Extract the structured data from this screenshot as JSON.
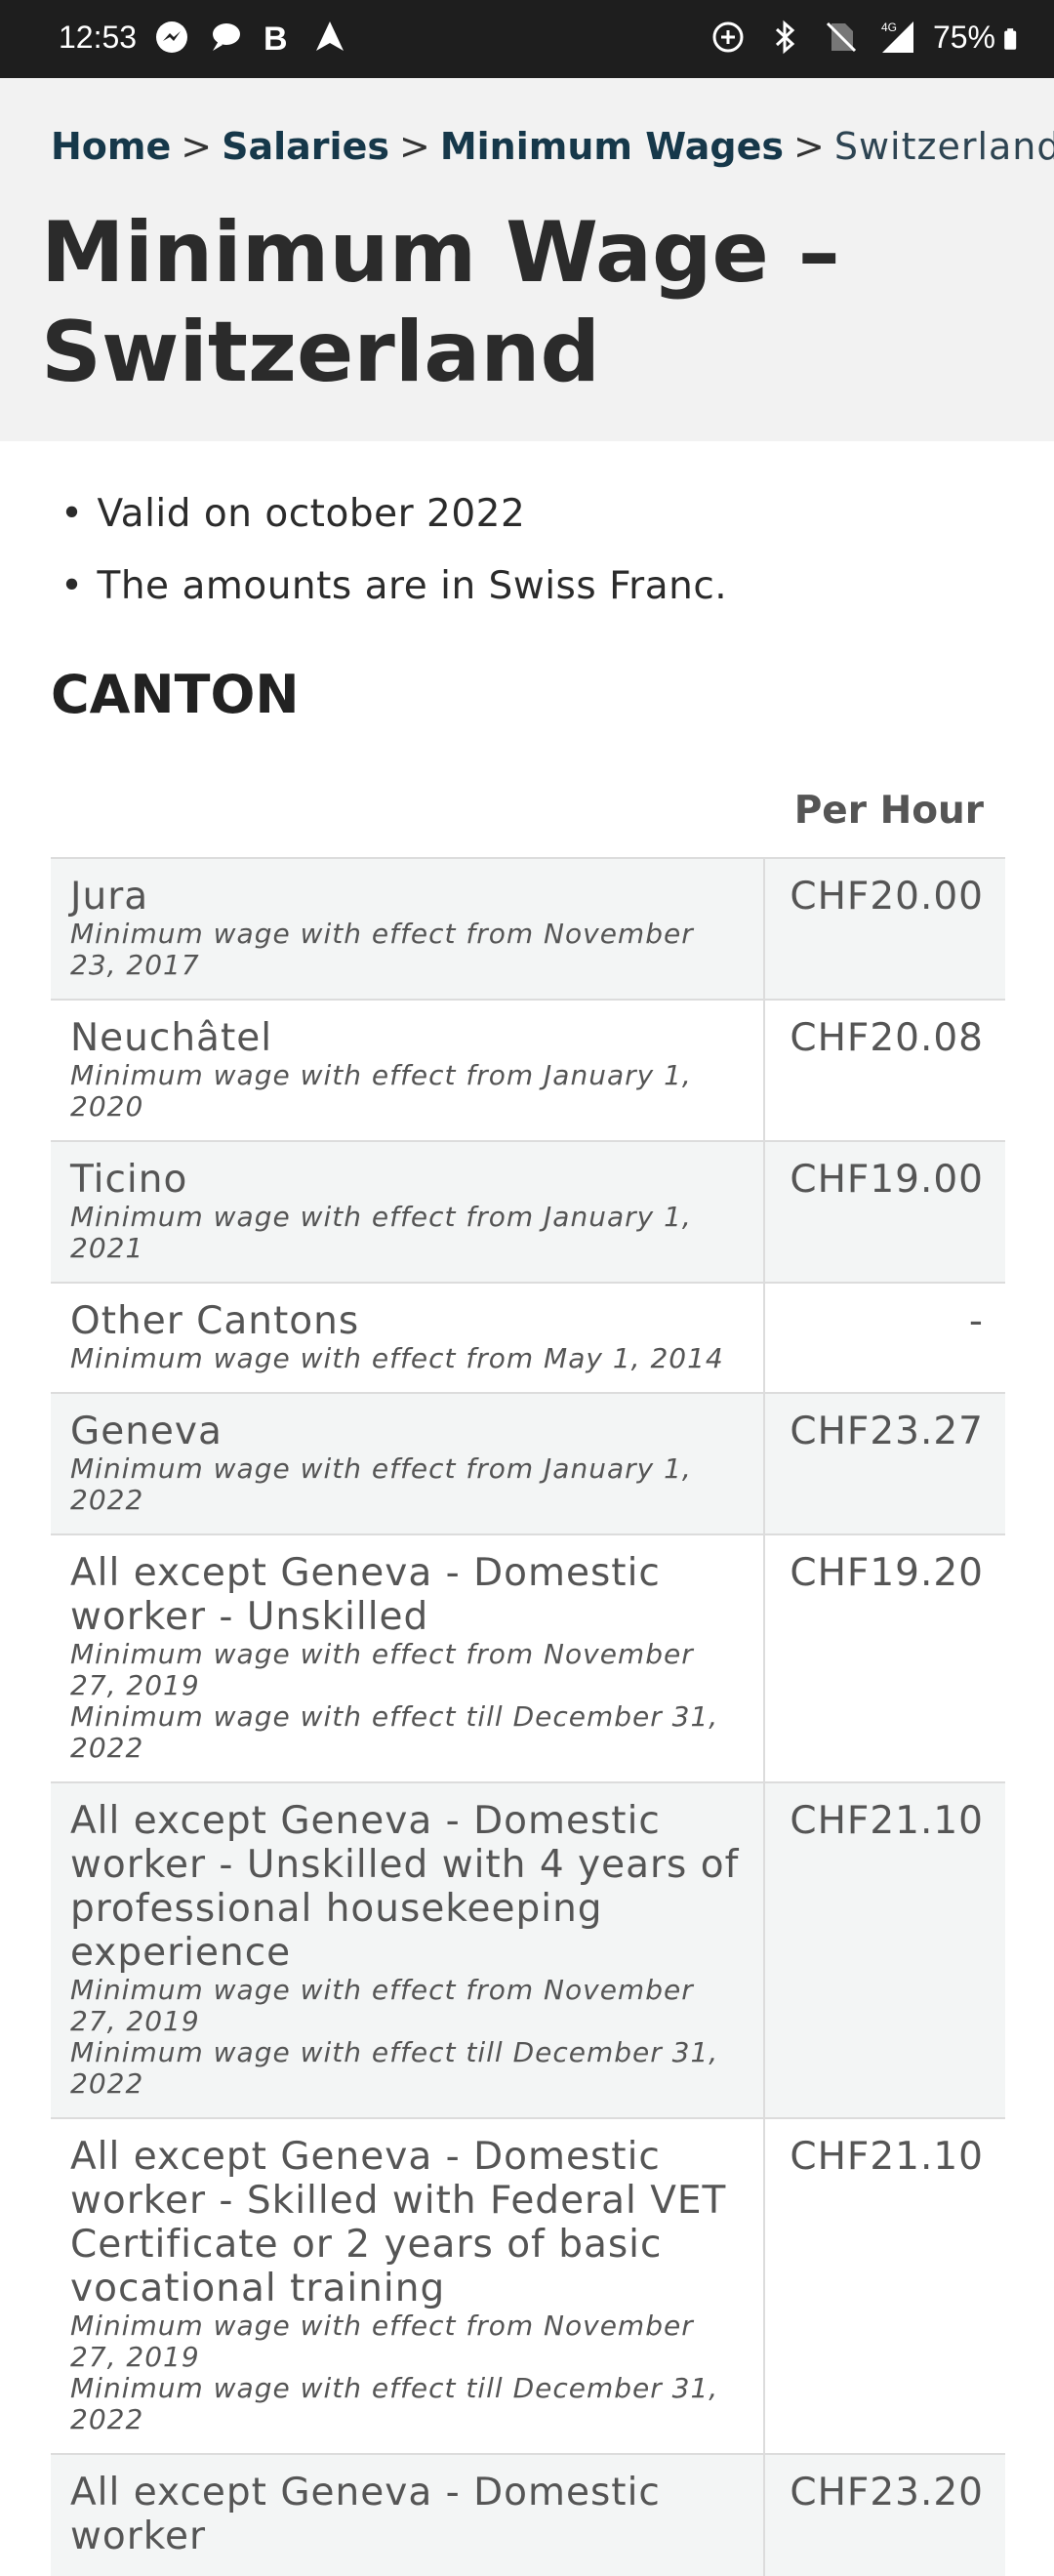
{
  "status_bar": {
    "time": "12:53",
    "left_icons": [
      "messenger-icon",
      "chat-bubble-icon",
      "bold-b-icon",
      "navigation-arrow-icon"
    ],
    "right_icons": [
      "data-saver-icon",
      "bluetooth-icon",
      "no-sim-icon",
      "signal-4g-icon"
    ],
    "battery_pct": "75%"
  },
  "breadcrumb": {
    "home": "Home",
    "salaries": "Salaries",
    "minimum_wages": "Minimum Wages",
    "current": "Switzerland",
    "separator": ">"
  },
  "page_title": "Minimum Wage – Switzerland",
  "notes": [
    "Valid on october 2022",
    "The amounts are in Swiss Franc."
  ],
  "section_title": "CANTON",
  "table": {
    "column_header": "Per Hour",
    "rows": [
      {
        "name": "Jura",
        "notes": [
          "Minimum wage with effect from November 23, 2017"
        ],
        "value": "CHF20.00"
      },
      {
        "name": "Neuchâtel",
        "notes": [
          "Minimum wage with effect from January 1, 2020"
        ],
        "value": "CHF20.08"
      },
      {
        "name": "Ticino",
        "notes": [
          "Minimum wage with effect from January 1, 2021"
        ],
        "value": "CHF19.00"
      },
      {
        "name": "Other Cantons",
        "notes": [
          "Minimum wage with effect from May 1, 2014"
        ],
        "value": "-"
      },
      {
        "name": "Geneva",
        "notes": [
          "Minimum wage with effect from January 1, 2022"
        ],
        "value": "CHF23.27"
      },
      {
        "name": "All except Geneva - Domestic worker - Unskilled",
        "notes": [
          "Minimum wage with effect from November 27, 2019",
          "Minimum wage with effect till December 31, 2022"
        ],
        "value": "CHF19.20"
      },
      {
        "name": "All except Geneva - Domestic worker - Unskilled with 4 years of professional housekeeping experience",
        "notes": [
          "Minimum wage with effect from November 27, 2019",
          "Minimum wage with effect till December 31, 2022"
        ],
        "value": "CHF21.10"
      },
      {
        "name": "All except Geneva - Domestic worker - Skilled with Federal VET Certificate or 2 years of basic vocational training",
        "notes": [
          "Minimum wage with effect from November 27, 2019",
          "Minimum wage with effect till December 31, 2022"
        ],
        "value": "CHF21.10"
      },
      {
        "name": "All except Geneva - Domestic worker",
        "notes": [],
        "value": "CHF23.20"
      }
    ]
  }
}
